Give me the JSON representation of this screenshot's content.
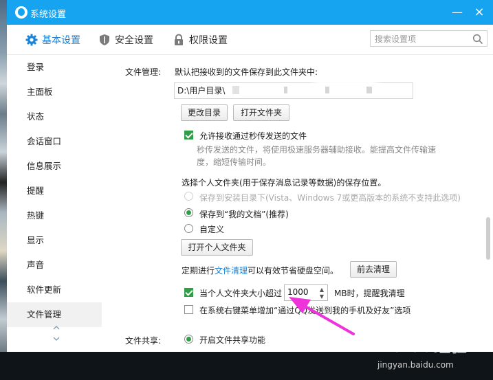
{
  "window": {
    "title": "系统设置",
    "minimize": "—",
    "close": "×"
  },
  "topnav": {
    "tabs": [
      {
        "label": "基本设置",
        "icon": "gear-icon",
        "active": true
      },
      {
        "label": "安全设置",
        "icon": "shield-icon"
      },
      {
        "label": "权限设置",
        "icon": "lock-icon"
      }
    ],
    "search_placeholder": "搜索设置项"
  },
  "sidebar": {
    "items": [
      {
        "label": "登录"
      },
      {
        "label": "主面板"
      },
      {
        "label": "状态"
      },
      {
        "label": "会话窗口"
      },
      {
        "label": "信息展示"
      },
      {
        "label": "提醒"
      },
      {
        "label": "热键"
      },
      {
        "label": "显示"
      },
      {
        "label": "声音"
      },
      {
        "label": "软件更新"
      },
      {
        "label": "文件管理",
        "active": true
      }
    ]
  },
  "file_mgmt": {
    "section_label": "文件管理:",
    "save_desc": "默认把接收到的文件保存到此文件夹中:",
    "path_value": "D:\\用户目录\\",
    "change_dir": "更改目录",
    "open_folder": "打开文件夹",
    "allow_flash_label": "允许接收通过秒传发送的文件",
    "flash_desc_1": "秒传发送的文件，将使用极速服务器辅助接收。能提高文件传输速",
    "flash_desc_2": "度，缩短传输时间。",
    "personal_title": "选择个人文件夹(用于保存消息记录等数据)的保存位置。",
    "radio_install": "保存到安装目录下(Vista、Windows 7或更高版本的系统不支持此选项)",
    "radio_docs": "保存到“我的文档”(推荐)",
    "radio_custom": "自定义",
    "open_personal": "打开个人文件夹",
    "cleanup_prefix": "定期进行",
    "cleanup_link": "文件清理",
    "cleanup_suffix": "可以有效节省硬盘空间。",
    "cleanup_btn": "前去清理",
    "size_prefix": "当个人文件夹大小超过",
    "size_value": "1000",
    "size_suffix": "MB时，提醒我清理",
    "context_menu_label": "在系统右键菜单增加“通过QQ发送到我的手机及好友”选项"
  },
  "file_share": {
    "section_label": "文件共享:",
    "enable_label": "开启文件共享功能"
  },
  "watermark": {
    "logo": "Baidu经验",
    "url": "jingyan.baidu.com"
  },
  "colors": {
    "titlebar": "#16a4f0",
    "check": "#2f9e46",
    "link": "#1e7fd0",
    "arrow": "#ee33dd"
  }
}
